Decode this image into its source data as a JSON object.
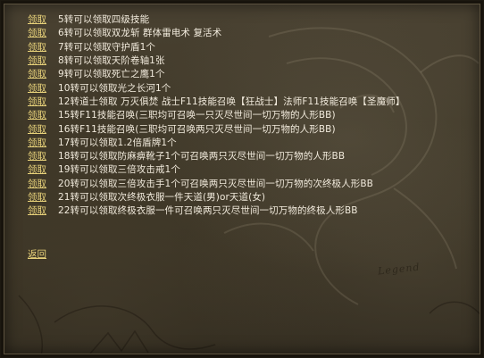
{
  "dialog": {
    "claim_label": "领取",
    "back_label": "返回",
    "watermark_text": "Legend",
    "rewards": [
      {
        "desc": "5转可以领取四级技能"
      },
      {
        "desc": "6转可以领取双龙斩 群体雷电术 复活术"
      },
      {
        "desc": "7转可以领取守护盾1个"
      },
      {
        "desc": "8转可以领取天阶卷轴1张"
      },
      {
        "desc": "9转可以领取死亡之鹰1个"
      },
      {
        "desc": "10转可以领取光之长河1个"
      },
      {
        "desc": "12转道士领取 万灭俱焚 战士F11技能召唤【狂战士】法师F11技能召唤【圣魔师】"
      },
      {
        "desc": "15转F11技能召唤(三职均可召唤一只灭尽世间一切万物的人形BB)"
      },
      {
        "desc": "16转F11技能召唤(三职均可召唤两只灭尽世间一切万物的人形BB)"
      },
      {
        "desc": "17转可以领取1.2倍盾牌1个"
      },
      {
        "desc": "18转可以领取防麻痹靴子1个可召唤两只灭尽世间一切万物的人形BB"
      },
      {
        "desc": "19转可以领取三倍攻击戒1个"
      },
      {
        "desc": "20转可以领取三倍攻击手1个可召唤两只灭尽世间一切万物的次终极人形BB"
      },
      {
        "desc": "21转可以领取次终极衣服一件天道(男)or天道(女)"
      },
      {
        "desc": "22转可以领取终极衣服一件可召唤两只灭尽世间一切万物的终极人形BB"
      }
    ]
  }
}
